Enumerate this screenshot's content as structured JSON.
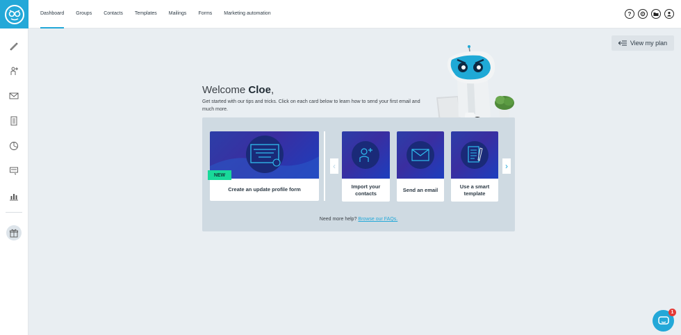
{
  "nav": {
    "items": [
      {
        "label": "Dashboard",
        "active": true
      },
      {
        "label": "Groups"
      },
      {
        "label": "Contacts"
      },
      {
        "label": "Templates"
      },
      {
        "label": "Mailings"
      },
      {
        "label": "Forms"
      },
      {
        "label": "Marketing automation"
      }
    ]
  },
  "top_icons": [
    "help-icon",
    "settings-icon",
    "folder-icon",
    "user-icon"
  ],
  "sidebar": {
    "icons": [
      "brush-icon",
      "add-contact-icon",
      "mail-icon",
      "document-icon",
      "pie-chart-icon",
      "form-icon",
      "bar-chart-icon",
      "gift-icon"
    ]
  },
  "plan_button": {
    "label": "View my plan"
  },
  "welcome": {
    "greeting": "Welcome ",
    "name": "Cloe",
    "comma": ",",
    "subtitle": "Get started with our tips and tricks. Click on each card below to learn how to send your first email and much more."
  },
  "cards": [
    {
      "label": "Create an update profile form",
      "badge": "NEW"
    },
    {
      "label": "Import your contacts"
    },
    {
      "label": "Send an email"
    },
    {
      "label": "Use a smart template"
    }
  ],
  "help": {
    "text": "Need more help? ",
    "link": "Browse our FAQs."
  },
  "chat": {
    "badge": "1"
  },
  "colors": {
    "accent": "#23a8d8",
    "new_badge": "#19d99a",
    "card_gradient": "#2c3ea8"
  }
}
